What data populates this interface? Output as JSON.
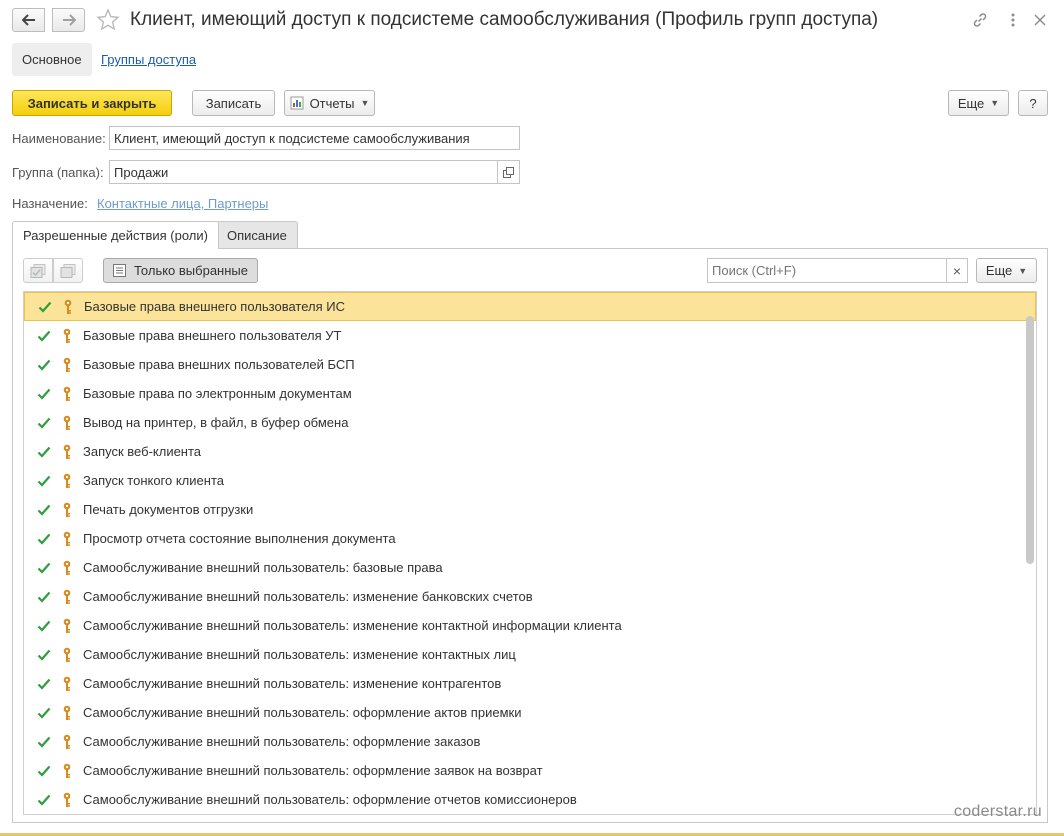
{
  "window": {
    "title": "Клиент, имеющий доступ к подсистеме самообслуживания (Профиль групп доступа)"
  },
  "sections": {
    "main": "Основное",
    "access_groups": "Группы доступа"
  },
  "toolbar": {
    "save_close": "Записать и закрыть",
    "save": "Записать",
    "reports": "Отчеты",
    "more": "Еще",
    "help": "?"
  },
  "fields": {
    "name_label": "Наименование:",
    "name_value": "Клиент, имеющий доступ к подсистеме самообслуживания",
    "group_label": "Группа (папка):",
    "group_value": "Продажи",
    "purpose_label": "Назначение:",
    "purpose_value": "Контактные лица, Партнеры"
  },
  "tabs": {
    "roles": "Разрешенные действия (роли)",
    "description": "Описание"
  },
  "roles_toolbar": {
    "only_selected": "Только выбранные",
    "search_placeholder": "Поиск (Ctrl+F)",
    "clear": "×",
    "more": "Еще"
  },
  "roles": [
    {
      "label": "Базовые права внешнего пользователя ИС",
      "checked": true,
      "selected": true
    },
    {
      "label": "Базовые права внешнего пользователя УТ",
      "checked": true
    },
    {
      "label": "Базовые права внешних пользователей БСП",
      "checked": true
    },
    {
      "label": "Базовые права по электронным документам",
      "checked": true
    },
    {
      "label": "Вывод на принтер, в файл, в буфер обмена",
      "checked": true
    },
    {
      "label": "Запуск веб-клиента",
      "checked": true
    },
    {
      "label": "Запуск тонкого клиента",
      "checked": true
    },
    {
      "label": "Печать документов отгрузки",
      "checked": true
    },
    {
      "label": "Просмотр отчета состояние выполнения документа",
      "checked": true
    },
    {
      "label": "Самообслуживание внешний пользователь: базовые права",
      "checked": true
    },
    {
      "label": "Самообслуживание внешний пользователь: изменение банковских счетов",
      "checked": true
    },
    {
      "label": "Самообслуживание внешний пользователь: изменение контактной информации клиента",
      "checked": true
    },
    {
      "label": "Самообслуживание внешний пользователь: изменение контактных лиц",
      "checked": true
    },
    {
      "label": "Самообслуживание внешний пользователь: изменение контрагентов",
      "checked": true
    },
    {
      "label": "Самообслуживание внешний пользователь: оформление актов приемки",
      "checked": true
    },
    {
      "label": "Самообслуживание внешний пользователь: оформление заказов",
      "checked": true
    },
    {
      "label": "Самообслуживание внешний пользователь: оформление заявок на возврат",
      "checked": true
    },
    {
      "label": "Самообслуживание внешний пользователь: оформление отчетов комиссионеров",
      "checked": true
    }
  ],
  "watermark": "coderstar.ru",
  "colors": {
    "primary_button": "#f5cf0b",
    "link": "#1a5ea8",
    "check": "#2e9e3e",
    "key": "#d98a1c",
    "selected_row": "#fbe49a"
  }
}
